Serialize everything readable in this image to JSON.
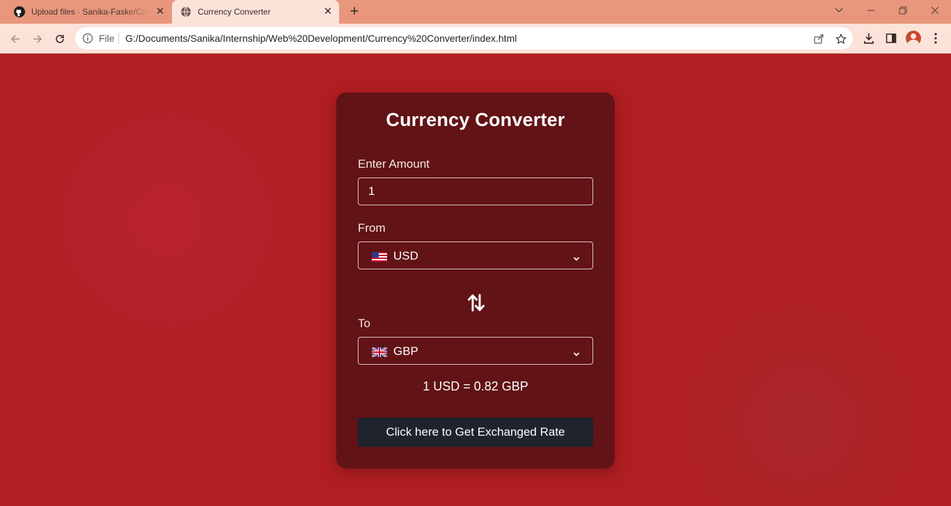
{
  "browser": {
    "tabs": [
      {
        "title": "Upload files · Sanika-Faske/Currency-Converter",
        "icon": "github-icon",
        "active": false
      },
      {
        "title": "Currency Converter",
        "icon": "globe-icon",
        "active": true
      }
    ],
    "address_bar": {
      "scheme_label": "File",
      "url": "G:/Documents/Sanika/Internship/Web%20Development/Currency%20Converter/index.html"
    },
    "theme_colors": {
      "tabstrip": "#e8977d",
      "toolbar": "#fbe3da"
    }
  },
  "converter": {
    "title": "Currency Converter",
    "amount_label": "Enter Amount",
    "amount_value": "1",
    "from_label": "From",
    "from_currency": "USD",
    "from_flag": "us-flag",
    "to_label": "To",
    "to_currency": "GBP",
    "to_flag": "uk-flag",
    "swap_icon": "swap-arrows-icon",
    "rate_text": "1 USD = 0.82 GBP",
    "button_label": "Click here to Get Exchanged Rate",
    "colors": {
      "page_bg": "#b11f22",
      "card_bg": "#621316",
      "button_bg": "#1e232d"
    }
  }
}
